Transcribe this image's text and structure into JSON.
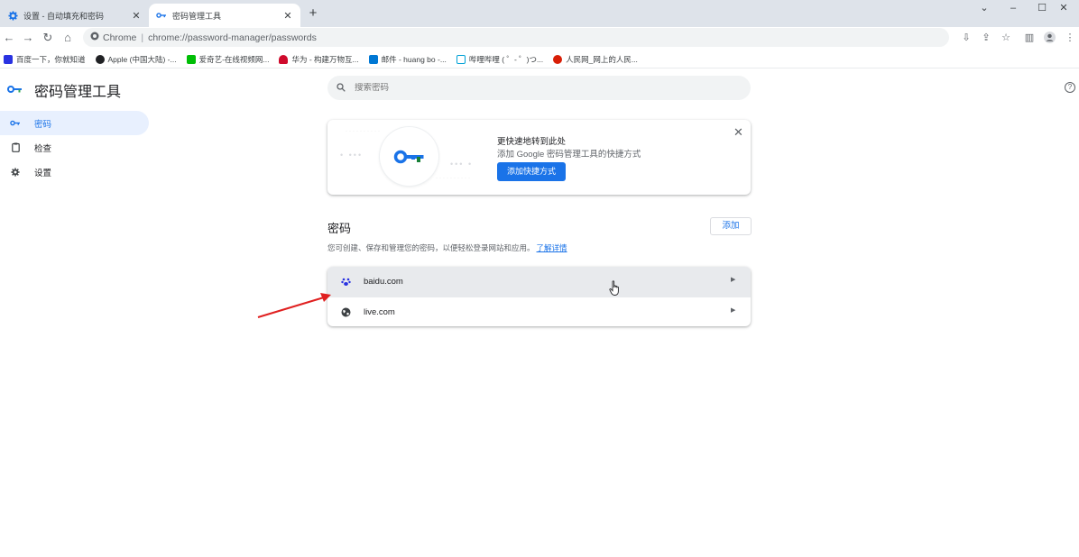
{
  "tabs": [
    {
      "title": "设置 - 自动填充和密码",
      "icon": "gear-icon"
    },
    {
      "title": "密码管理工具",
      "icon": "key-icon"
    }
  ],
  "new_tab": "+",
  "window_controls": {
    "minimize": "–",
    "maximize": "☐",
    "close": "✕",
    "tab_search": "⌄"
  },
  "address_bar": {
    "label": "Chrome",
    "separator": "|",
    "url": "chrome://password-manager/passwords"
  },
  "bookmarks": [
    {
      "label": "百度一下，你就知道",
      "color": "#2932e1"
    },
    {
      "label": "Apple (中国大陆) -...",
      "color": "#202124"
    },
    {
      "label": "爱奇艺-在线视频网...",
      "color": "#00be06"
    },
    {
      "label": "华为 - 构建万物互...",
      "color": "#cf0a2c"
    },
    {
      "label": "邮件 - huang bo -...",
      "color": "#0078d4"
    },
    {
      "label": "哔哩哔哩 ( ゜- ゜)つ...",
      "color": "#00a1d6"
    },
    {
      "label": "人民网_网上的人民...",
      "color": "#d81e06"
    }
  ],
  "app": {
    "title": "密码管理工具"
  },
  "sidebar": {
    "items": [
      {
        "label": "密码",
        "icon": "key-icon",
        "selected": true
      },
      {
        "label": "检查",
        "icon": "clipboard-check-icon",
        "selected": false
      },
      {
        "label": "设置",
        "icon": "gear-icon",
        "selected": false
      }
    ]
  },
  "search": {
    "placeholder": "搜索密码"
  },
  "promo": {
    "title": "更快速地转到此处",
    "description": "添加 Google 密码管理工具的快捷方式",
    "button": "添加快捷方式"
  },
  "passwords": {
    "title": "密码",
    "add_label": "添加",
    "description": "您可创建、保存和管理您的密码，以便轻松登录网站和应用。",
    "learn_more": "了解详情",
    "items": [
      {
        "site": "baidu.com",
        "icon": "baidu-paw-icon"
      },
      {
        "site": "live.com",
        "icon": "globe-icon"
      }
    ]
  },
  "colors": {
    "accent": "#1a73e8",
    "annotation_arrow": "#e02020"
  }
}
